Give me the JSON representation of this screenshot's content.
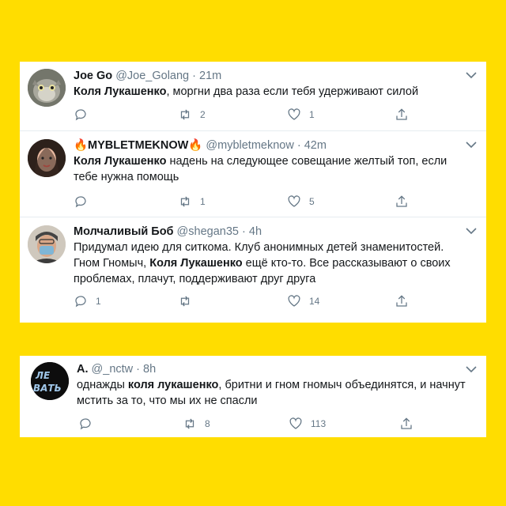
{
  "colors": {
    "background": "#FFDD00",
    "text": "#14171a",
    "muted": "#657786",
    "divider": "#e6ecf0"
  },
  "tweets": [
    {
      "name": "Joe Go",
      "handle": "@Joe_Golang",
      "time": "21m",
      "text": {
        "parts": [
          {
            "t": "Коля Лукашенко",
            "bold": true
          },
          {
            "t": ", моргни два раза если тебя удерживают силой",
            "bold": false
          }
        ]
      },
      "reply_count": "",
      "retweet_count": "2",
      "like_count": "1"
    },
    {
      "name": "🔥MYBLETMEKNOW🔥",
      "handle": "@mybletmeknow",
      "time": "42m",
      "text": {
        "parts": [
          {
            "t": "Коля Лукашенко",
            "bold": true
          },
          {
            "t": " надень на следующее совещание желтый топ, если тебе нужна помощь",
            "bold": false
          }
        ]
      },
      "reply_count": "",
      "retweet_count": "1",
      "like_count": "5"
    },
    {
      "name": "Молчаливый Боб",
      "handle": "@shegan35",
      "time": "4h",
      "text": {
        "parts": [
          {
            "t": "Придумал идею для ситкома. Клуб анонимных детей знаменитостей. Гном Гномыч, ",
            "bold": false
          },
          {
            "t": "Коля Лукашенко",
            "bold": true
          },
          {
            "t": " ещё кто-то. Все рассказывают о своих проблемах, плачут, поддерживают друг друга",
            "bold": false
          }
        ]
      },
      "reply_count": "1",
      "retweet_count": "",
      "like_count": "14"
    },
    {
      "name": "A.",
      "handle": "@_nctw",
      "time": "8h",
      "text": {
        "parts": [
          {
            "t": "однажды ",
            "bold": false
          },
          {
            "t": "коля лукашенко",
            "bold": true
          },
          {
            "t": ", бритни и гном гномыч объединятся, и начнут мстить за то, что мы их не спасли",
            "bold": false
          }
        ]
      },
      "avatar_text": "ЛЕ ВАТЬ",
      "reply_count": "",
      "retweet_count": "8",
      "like_count": "113"
    }
  ]
}
